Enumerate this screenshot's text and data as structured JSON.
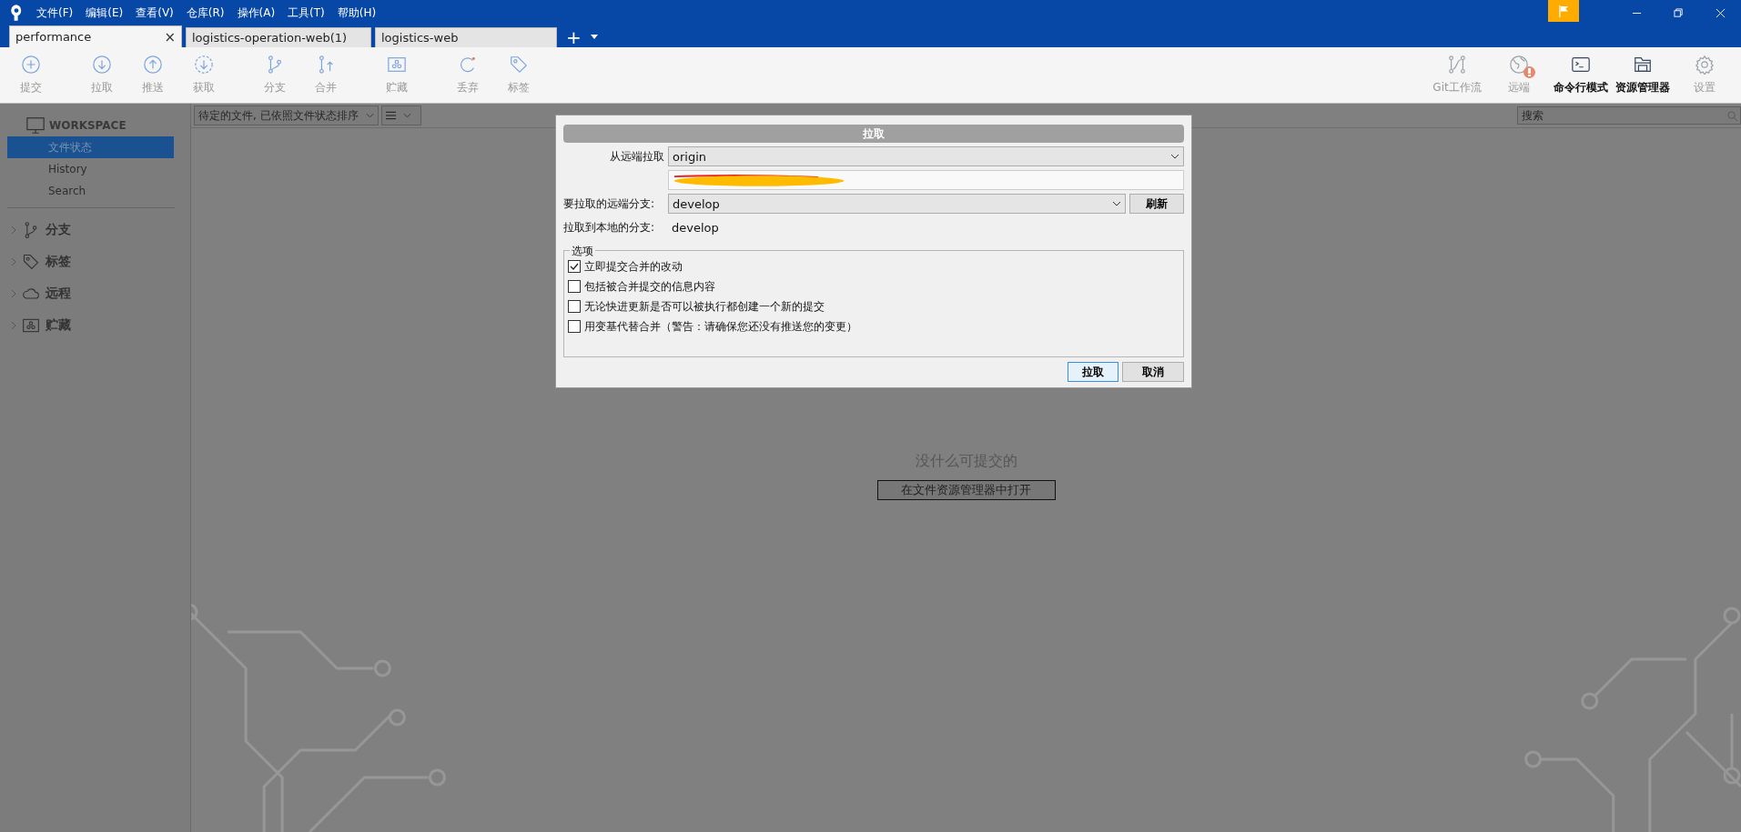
{
  "menu": [
    "文件(F)",
    "编辑(E)",
    "查看(V)",
    "仓库(R)",
    "操作(A)",
    "工具(T)",
    "帮助(H)"
  ],
  "tabs": [
    {
      "label": "performance",
      "selected": true,
      "close": "×"
    },
    {
      "label": "logistics-operation-web(1)",
      "selected": false
    },
    {
      "label": "logistics-web",
      "selected": false
    }
  ],
  "tab_add": "+",
  "toolbar_left": [
    [
      {
        "label": "提交",
        "disabled": true
      }
    ],
    [
      {
        "label": "拉取",
        "disabled": true
      },
      {
        "label": "推送",
        "disabled": true
      },
      {
        "label": "获取",
        "disabled": true
      }
    ],
    [
      {
        "label": "分支",
        "disabled": true
      },
      {
        "label": "合并",
        "disabled": true
      }
    ],
    [
      {
        "label": "贮藏",
        "disabled": true
      }
    ],
    [
      {
        "label": "丢弃",
        "disabled": true
      },
      {
        "label": "标签",
        "disabled": true
      }
    ]
  ],
  "toolbar_right": [
    {
      "label": "Git工作流",
      "disabled": true,
      "alert": false
    },
    {
      "label": "远端",
      "disabled": true,
      "alert": true
    },
    {
      "label": "命令行模式",
      "disabled": false,
      "alert": false
    },
    {
      "label": "资源管理器",
      "disabled": false,
      "alert": false
    },
    {
      "label": "设置",
      "disabled": true,
      "alert": false
    }
  ],
  "sidebar": {
    "workspace": "WORKSPACE",
    "items": [
      {
        "label": "文件状态",
        "selected": true
      },
      {
        "label": "History",
        "selected": false
      },
      {
        "label": "Search",
        "selected": false
      }
    ],
    "sections": [
      {
        "label": "分支",
        "expanded": false
      },
      {
        "label": "标签",
        "expanded": false
      },
      {
        "label": "远程",
        "expanded": false
      },
      {
        "label": "贮藏",
        "expanded": false
      }
    ]
  },
  "filter": {
    "sort": "待定的文件, 已依照文件状态排序"
  },
  "search": {
    "placeholder": "搜索"
  },
  "empty": {
    "message": "没什么可提交的",
    "button": "在文件资源管理器中打开"
  },
  "dialog": {
    "title": "拉取",
    "remote_label": "从远端拉取",
    "remote": "origin",
    "branch_label": "要拉取的远端分支:",
    "branch": "develop",
    "refresh": "刷新",
    "local_label": "拉取到本地的分支:",
    "local": "develop",
    "options_title": "选项",
    "options": [
      {
        "label": "立即提交合并的改动",
        "checked": true
      },
      {
        "label": "包括被合并提交的信息内容",
        "checked": false
      },
      {
        "label": "无论快进更新是否可以被执行都创建一个新的提交",
        "checked": false
      },
      {
        "label": "用变基代替合并（警告：请确保您还没有推送您的变更）",
        "checked": false
      }
    ],
    "buttons": [
      {
        "label": "拉取",
        "default": true
      },
      {
        "label": "取消",
        "default": false
      }
    ]
  }
}
